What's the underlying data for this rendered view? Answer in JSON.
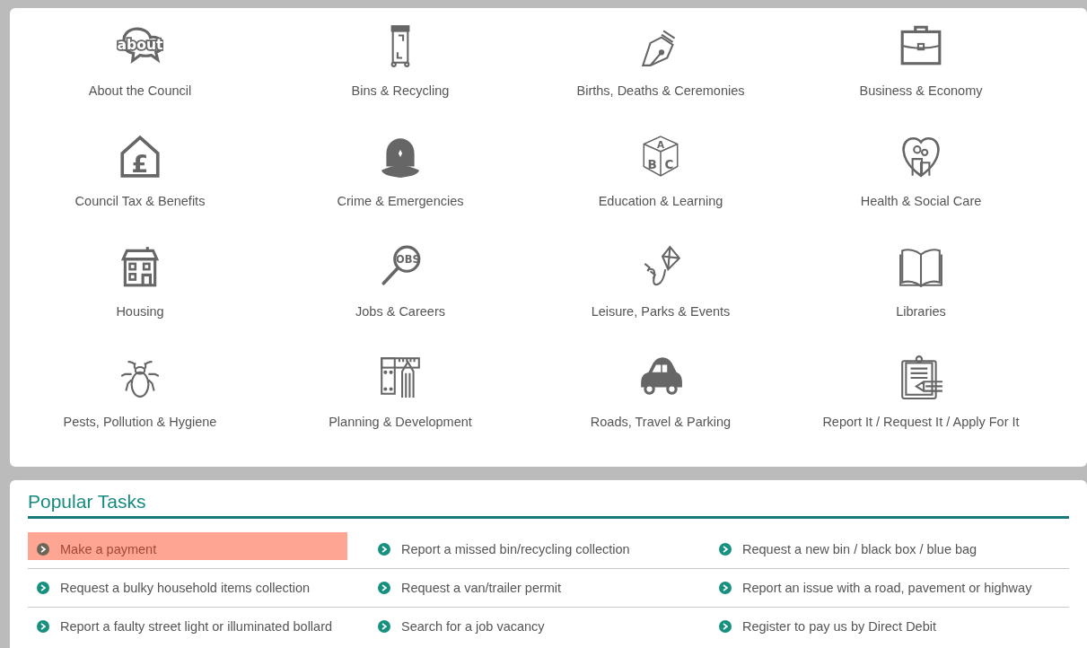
{
  "services": [
    {
      "label": "About the Council",
      "icon_text": "about"
    },
    {
      "label": "Bins & Recycling"
    },
    {
      "label": "Births, Deaths & Ceremonies"
    },
    {
      "label": "Business & Economy"
    },
    {
      "label": "Council Tax & Benefits",
      "icon_text": "£"
    },
    {
      "label": "Crime & Emergencies"
    },
    {
      "label": "Education & Learning",
      "icon_letters": [
        "A",
        "B",
        "C"
      ]
    },
    {
      "label": "Health & Social Care"
    },
    {
      "label": "Housing"
    },
    {
      "label": "Jobs & Careers",
      "icon_text": "OBS"
    },
    {
      "label": "Leisure, Parks & Events"
    },
    {
      "label": "Libraries"
    },
    {
      "label": "Pests, Pollution & Hygiene"
    },
    {
      "label": "Planning & Development"
    },
    {
      "label": "Roads, Travel & Parking"
    },
    {
      "label": "Report It / Request It / Apply For It"
    }
  ],
  "popular_tasks": {
    "title": "Popular Tasks",
    "items": [
      {
        "label": "Make a payment",
        "selected": true
      },
      {
        "label": "Report a missed bin/recycling collection",
        "selected": false
      },
      {
        "label": "Request a new bin / black box / blue bag",
        "selected": false
      },
      {
        "label": "Request a bulky household items collection",
        "selected": false
      },
      {
        "label": "Request a van/trailer permit",
        "selected": false
      },
      {
        "label": "Report an issue with a road, pavement or highway",
        "selected": false
      },
      {
        "label": "Report a faulty street light or illuminated bollard",
        "selected": false
      },
      {
        "label": "Search for a job vacancy",
        "selected": false
      },
      {
        "label": "Register to pay us by Direct Debit",
        "selected": false
      }
    ]
  }
}
